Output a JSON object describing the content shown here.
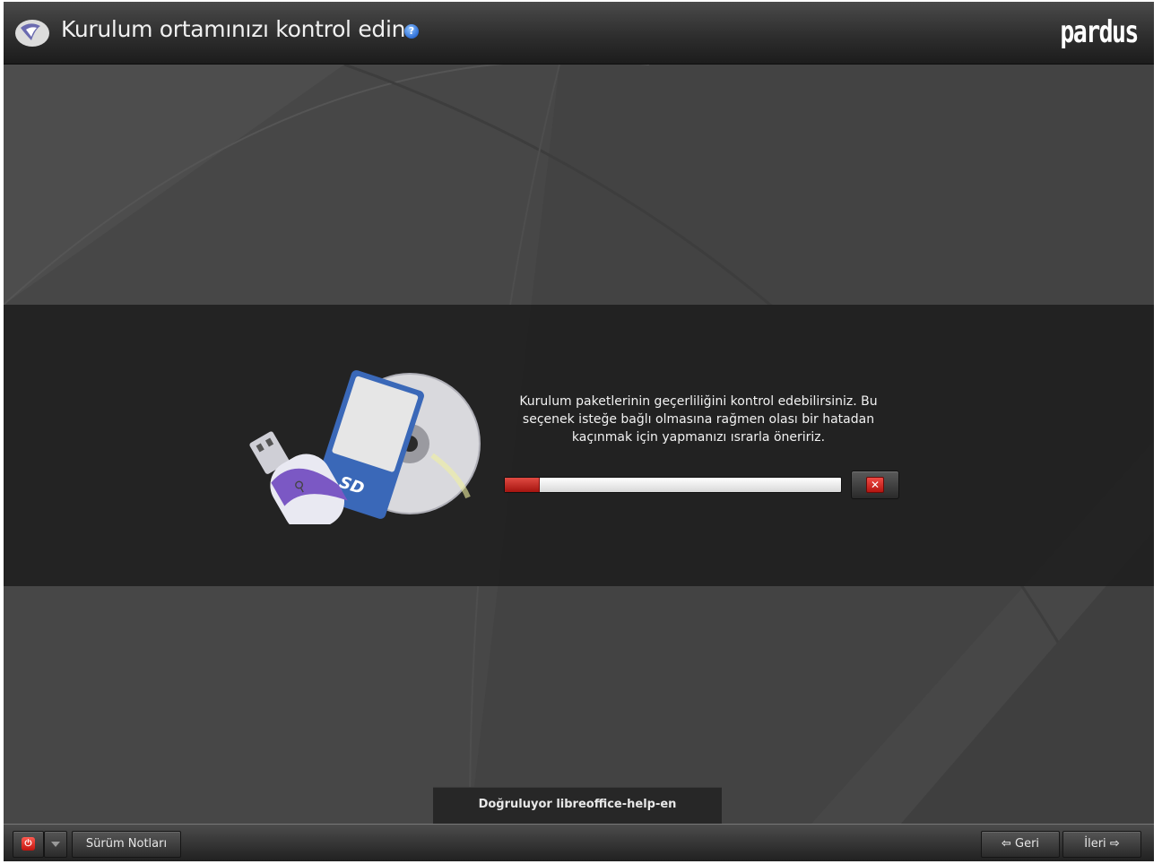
{
  "header": {
    "title": "Kurulum ortamınızı kontrol edin",
    "help_icon": "question-mark",
    "brand": "pardus"
  },
  "main": {
    "description": "Kurulum paketlerinin geçerliliğini kontrol edebilirsiniz. Bu seçenek isteğe bağlı olmasına rağmen olası bir hatadan kaçınmak için yapmanızı ısrarla öneririz.",
    "progress": 0.1,
    "cancel_icon": "red-x-icon"
  },
  "status": {
    "text": "Doğruluyor libreoffice-help-en"
  },
  "footer": {
    "power_icon": "power-icon",
    "release_notes_label": "Sürüm Notları",
    "back_label": "Geri",
    "next_label": "İleri"
  },
  "colors": {
    "header_bg": "#2e2e2e",
    "band_bg": "#202020",
    "progress_fill": "#c0201a",
    "cancel_red": "#d5241d"
  }
}
